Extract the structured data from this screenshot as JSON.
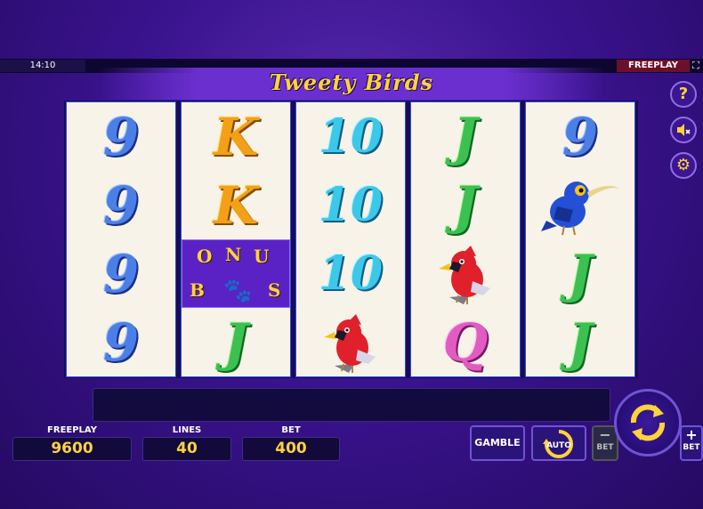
{
  "status": {
    "time": "14:10",
    "mode": "FREEPLAY"
  },
  "game": {
    "title": "Tweety Birds"
  },
  "reels": [
    [
      "9",
      "9",
      "9",
      "9"
    ],
    [
      "K",
      "K",
      "BONUS",
      "J"
    ],
    [
      "10",
      "10",
      "10",
      "cardinal-bird"
    ],
    [
      "J",
      "J",
      "cardinal-bird",
      "Q"
    ],
    [
      "9",
      "blue-hummingbird",
      "J",
      "J"
    ]
  ],
  "bonus_symbol": {
    "letters": [
      "O",
      "N",
      "U",
      "B",
      "S"
    ]
  },
  "side_buttons": {
    "help": "?",
    "sound": "speaker-muted",
    "settings": "gear"
  },
  "panels": {
    "freeplay_label": "FREEPLAY",
    "freeplay_value": "9600",
    "lines_label": "LINES",
    "lines_value": "40",
    "bet_label": "BET",
    "bet_value": "400"
  },
  "controls": {
    "gamble_label": "GAMBLE",
    "auto_label": "AUTO",
    "bet_minus_sign": "−",
    "bet_minus_label": "BET",
    "bet_plus_sign": "+",
    "bet_plus_label": "BET"
  },
  "colors": {
    "accent": "#ffd23c",
    "background": "#2a0c6e",
    "reel_bg": "#f7f3e8",
    "freeplay_tag": "#6d0f2a"
  }
}
